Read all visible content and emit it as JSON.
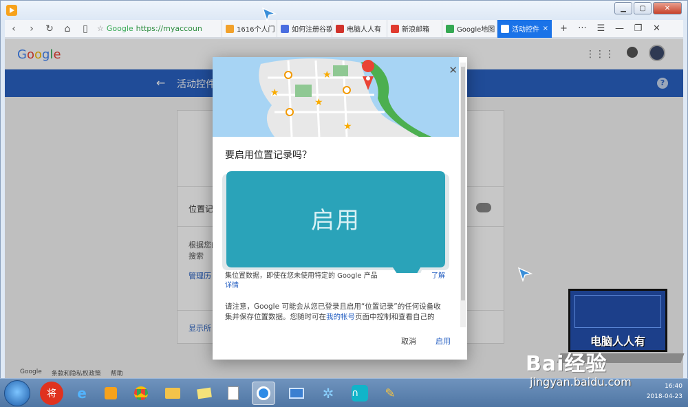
{
  "browser": {
    "address_prefix": "Google",
    "url": "https://myaccoun",
    "tabs": [
      {
        "label": "1616个人门",
        "color": "#f2a12b"
      },
      {
        "label": "如何注册谷歌",
        "color": "#4a6ee0"
      },
      {
        "label": "电脑人人有",
        "color": "#d0322b"
      },
      {
        "label": "新浪邮箱",
        "color": "#e03b2f"
      },
      {
        "label": "Google地图",
        "color": "#34a853"
      },
      {
        "label": "活动控件",
        "color": "#4285f4"
      }
    ],
    "active_tab_close": "×",
    "new_tab": "+",
    "more": "···",
    "menu": "☰"
  },
  "page": {
    "logo": "Google",
    "header_title": "活动控件",
    "setting_label": "位置记",
    "desc_text": "根据您的图搜索",
    "manage_link": "管理历",
    "show_all_link": "显示所",
    "footer": {
      "google": "Google",
      "terms": "条款和隐私权政策",
      "help": "帮助"
    }
  },
  "dialog": {
    "question": "要启用位置记录吗？",
    "overlay_label": "启用",
    "partial_text": "集位置数据，即使在您未使用特定的 Google 产品",
    "partial_more": "详情",
    "partial_more2": "了解",
    "notice_before": "请注意，Google 可能会从您已登录且启用“位置记录”的任何设备收集并保存位置数据。您随时可在",
    "notice_link": "我的帐号",
    "notice_after": "页面中控制和查看自己的",
    "cancel": "取消",
    "enable": "启用"
  },
  "watermark": {
    "image_title": "电脑人人有",
    "baidu": "Bai经验",
    "url": "jingyan.baidu.com"
  },
  "taskbar": {
    "time": "16:40",
    "date": "2018-04-23"
  },
  "colors": {
    "google_blue": "#2962c3",
    "teal_overlay": "#2aa3b9",
    "active_tab": "#1a73e8"
  }
}
